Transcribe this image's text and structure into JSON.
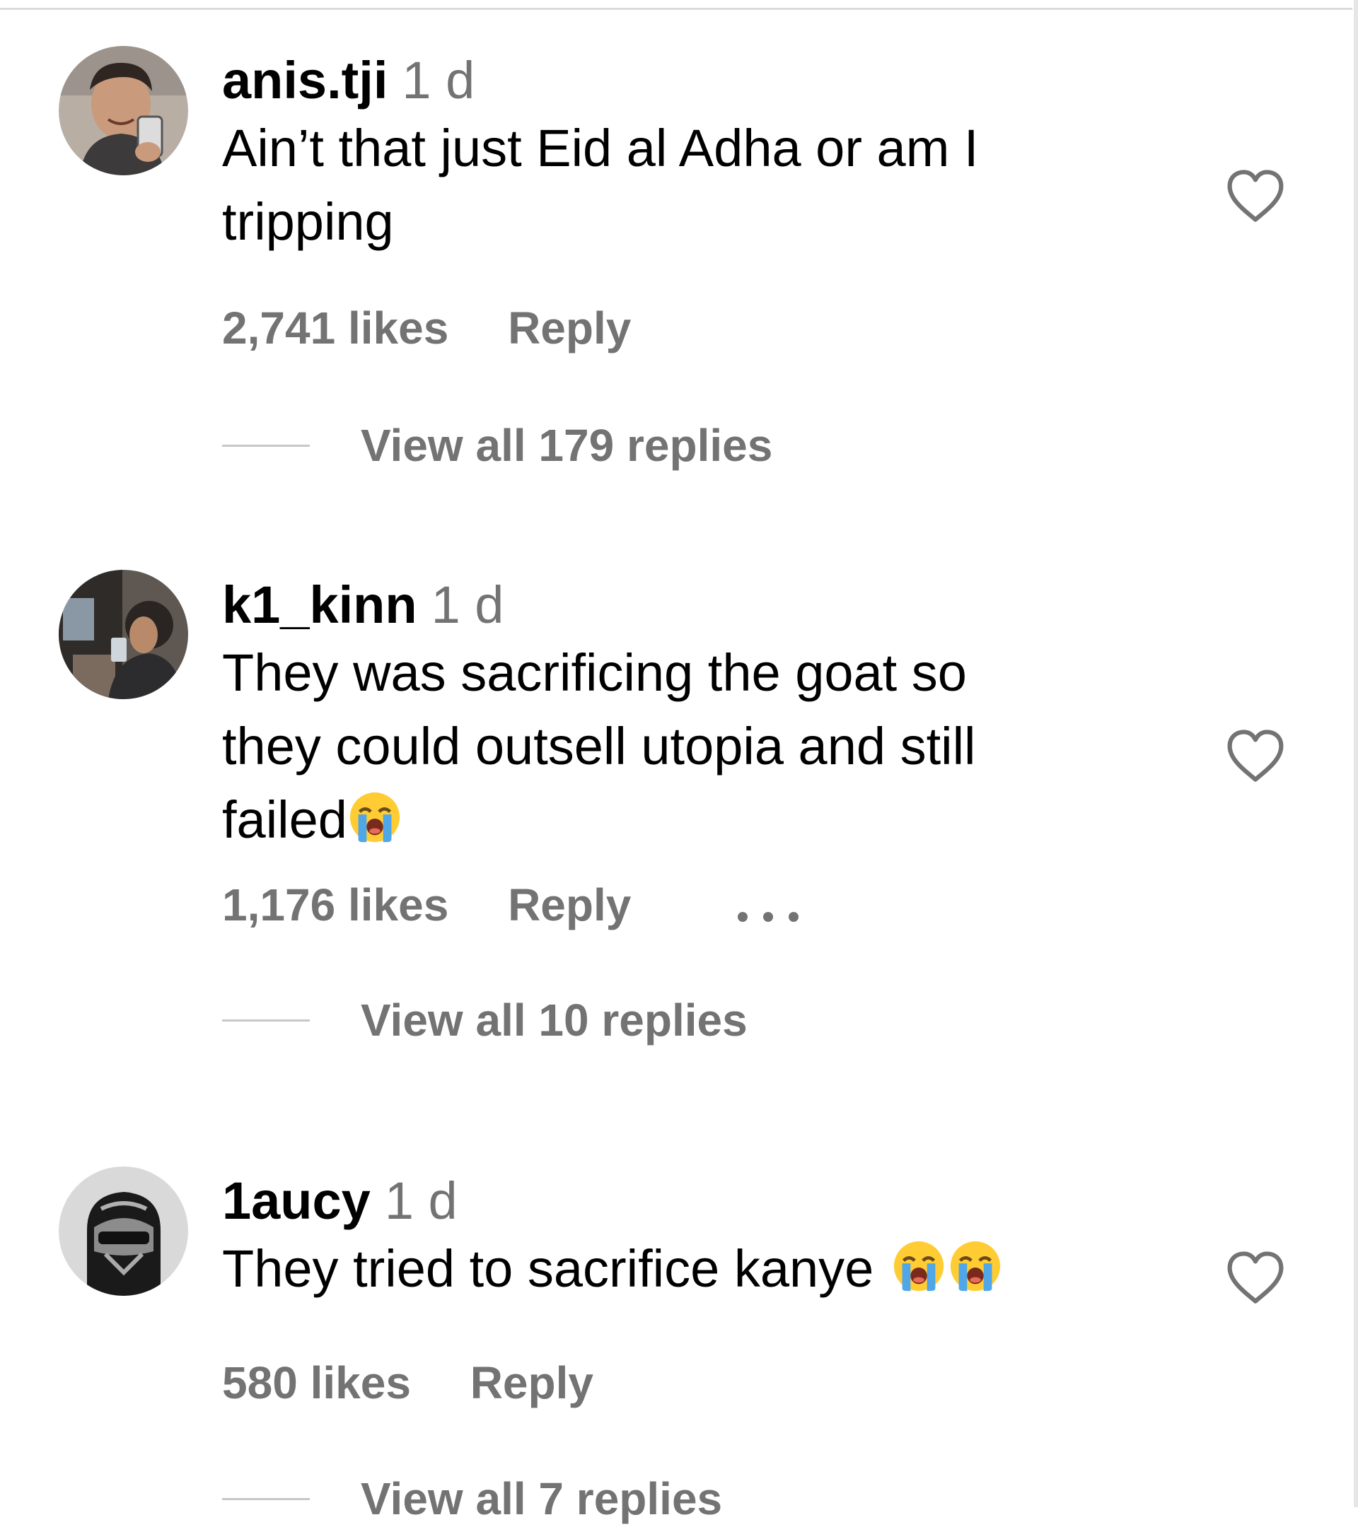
{
  "comments": [
    {
      "username": "anis.tji",
      "time": "1 d",
      "text_lines": [
        "Ain’t that just Eid al Adha or am I",
        "tripping"
      ],
      "emoji_count": 0,
      "likes": "2,741 likes",
      "reply_label": "Reply",
      "view_replies": "View all 179 replies",
      "has_more_menu": false
    },
    {
      "username": "k1_kinn",
      "time": "1 d",
      "text_lines": [
        "They was sacrificing the goat so",
        "they could outsell utopia and still",
        "failed"
      ],
      "emoji_count": 1,
      "emoji": "😭",
      "likes": "1,176 likes",
      "reply_label": "Reply",
      "view_replies": "View all 10 replies",
      "has_more_menu": true,
      "more_label": "•••"
    },
    {
      "username": "1aucy",
      "time": "1 d",
      "text_lines": [
        "They tried to sacrifice kanye "
      ],
      "emoji_count": 2,
      "emoji": "😭",
      "likes": "580 likes",
      "reply_label": "Reply",
      "view_replies": "View all 7 replies",
      "has_more_menu": false
    }
  ],
  "icons": {
    "like": "heart-outline-icon",
    "more": "more-horizontal-icon",
    "emoji": "loudly-crying-face"
  },
  "colors": {
    "text": "#000000",
    "secondary": "#737373",
    "divider": "#dbdbdb",
    "view_line": "#c7c7c7"
  }
}
